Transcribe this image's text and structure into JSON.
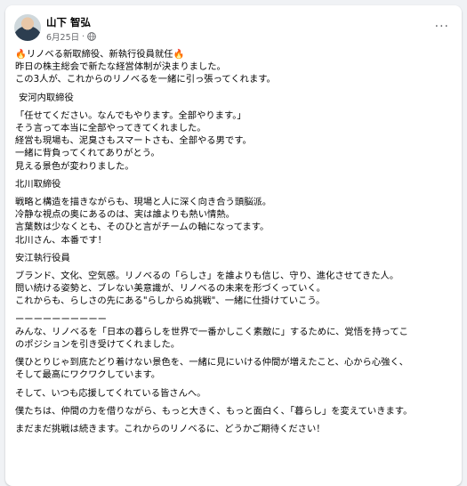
{
  "post": {
    "author": "山下 智弘",
    "date": "6月25日",
    "dot": "·",
    "more_glyph": "···",
    "icons": [
      "avatar",
      "globe-icon",
      "more-options-icon",
      "fire-emoji-icon"
    ]
  },
  "body": {
    "headline": "リノベる新取締役、新執行役員就任",
    "fire": "🔥",
    "intro": [
      "昨日の株主総会で新たな経営体制が決まりました。",
      "この3人が、これからのリノベるを一緒に引っ張ってくれます。"
    ],
    "person1": {
      "role": "安河内取締役",
      "lines": [
        "「任せてください。なんでもやります。全部やります。」",
        "そう言って本当に全部やってきてくれました。",
        "経営も現場も、泥臭さもスマートさも、全部やる男です。",
        "一緒に背負ってくれてありがとう。",
        "見える景色が変わりました。"
      ]
    },
    "person2": {
      "role": "北川取締役",
      "lines": [
        "戦略と構造を描きながらも、現場と人に深く向き合う頭脳派。",
        "冷静な視点の奥にあるのは、実は誰よりも熱い情熱。",
        "言葉数は少なくとも、そのひと言がチームの軸になってます。",
        "北川さん、本番です！"
      ]
    },
    "person3": {
      "role": "安江執行役員",
      "lines": [
        "ブランド、文化、空気感。リノベるの「らしさ」を誰よりも信じ、守り、進化させてきた人。",
        "問い続ける姿勢と、ブレない美意識が、リノベるの未来を形づくっていく。",
        "これからも、らしさの先にある\"らしからぬ挑戦\"、一緒に仕掛けていこう。"
      ]
    },
    "divider": "ーーーーーーーーーー",
    "closing": {
      "p1": [
        "みんな、リノベるを「日本の暮らしを世界で一番かしこく素敵に」するために、覚悟を持ってこ",
        "のポジションを引き受けてくれました。"
      ],
      "p2": [
        "僕ひとりじゃ到底たどり着けない景色を、一緒に見にいける仲間が増えたこと、心から心強く、",
        "そして最高にワクワクしています。"
      ],
      "p3": [
        "そして、いつも応援してくれている皆さんへ。"
      ],
      "p4": [
        "僕たちは、仲間の力を借りながら、もっと大きく、もっと面白く、「暮らし」を変えていきます。"
      ],
      "p5": [
        "まだまだ挑戦は続きます。これからのリノベるに、どうかご期待ください！"
      ]
    }
  }
}
